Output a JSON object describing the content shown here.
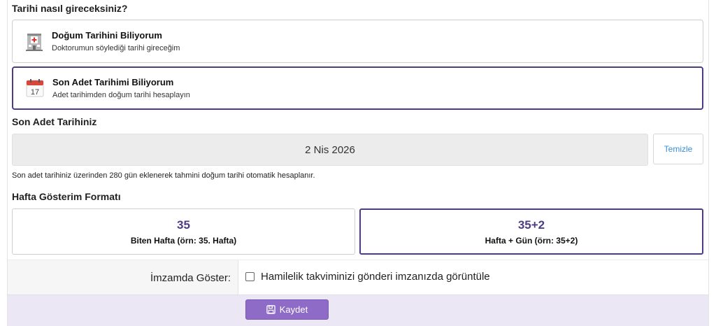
{
  "question": {
    "title": "Tarihi nasıl gireceksiniz?"
  },
  "options": [
    {
      "title": "Doğum Tarihini Biliyorum",
      "subtitle": "Doktorumun söylediği tarihi gireceğim",
      "icon": "hospital-icon",
      "selected": false
    },
    {
      "title": "Son Adet Tarihimi Biliyorum",
      "subtitle": "Adet tarihimden doğum tarihi hesaplayın",
      "icon": "calendar-icon",
      "icon_text": "17",
      "selected": true
    }
  ],
  "lmp": {
    "title": "Son Adet Tarihiniz",
    "value": "2 Nis 2026",
    "clear_label": "Temizle",
    "hint": "Son adet tarihiniz üzerinden 280 gün eklenerek tahmini doğum tarihi otomatik hesaplanır."
  },
  "week_format": {
    "title": "Hafta Gösterim Formatı",
    "options": [
      {
        "value": "35",
        "label": "Biten Hafta (örn: 35. Hafta)",
        "selected": false
      },
      {
        "value": "35+2",
        "label": "Hafta + Gün (örn: 35+2)",
        "selected": true
      }
    ]
  },
  "signature": {
    "label": "İmzamda Göster:",
    "checkbox_label": "Hamilelik takviminizi gönderi imzanızda görüntüle",
    "checked": false
  },
  "footer": {
    "save_label": "Kaydet",
    "save_icon": "floppy-disk-icon"
  },
  "colors": {
    "accent": "#4e3b86",
    "button": "#8d6bc6",
    "footer_bg": "#ebe7f5",
    "link": "#3a8fd4"
  }
}
